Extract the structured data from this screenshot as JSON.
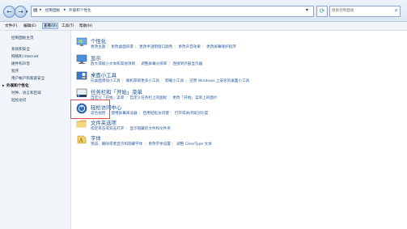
{
  "address": {
    "crumbs": [
      "控制面板",
      "外观和个性化"
    ],
    "search_placeholder": "搜索控制面板"
  },
  "menu": [
    "文件(F)",
    "编辑(E)",
    "查看(V)",
    "工具(T)",
    "帮助(H)"
  ],
  "sidebar": {
    "items": [
      "控制面板主页",
      "系统和安全",
      "网络和 Internet",
      "硬件和声音",
      "程序",
      "用户帐户和家庭安全",
      "外观和个性化",
      "时钟、语言和区域",
      "轻松访问"
    ]
  },
  "categories": [
    {
      "title": "个性化",
      "links": [
        "更改主题",
        "更改桌面背景",
        "更改半透明窗口颜色",
        "更改声音效果",
        "更改屏幕保护程序"
      ]
    },
    {
      "title": "显示",
      "links": [
        "放大或缩小文本和其他项目",
        "调整屏幕分辨率",
        "连接到外部显示器"
      ]
    },
    {
      "title": "桌面小工具",
      "links": [
        "向桌面添加小工具",
        "联机获取更多小工具",
        "卸载小工具",
        "还原 Windows 上安装的桌面小工具"
      ]
    },
    {
      "title": "任务栏和「开始」菜单",
      "links": [
        "自定义「开始」菜单",
        "自定义任务栏上的图标",
        "更改「开始」菜单上的图片"
      ]
    },
    {
      "title": "轻松访问中心",
      "links": [
        "适合视觉",
        "使用屏幕阅读器",
        "启用轻松访问键",
        "打开或关闭高对比度"
      ]
    },
    {
      "title": "文件夹选项",
      "links": [
        "指定单击或双击打开",
        "显示隐藏的文件和文件夹"
      ]
    },
    {
      "title": "字体",
      "links": [
        "预览、删除或者显示和隐藏字体",
        "更改字体设置",
        "调整 ClearType 文本"
      ]
    }
  ]
}
